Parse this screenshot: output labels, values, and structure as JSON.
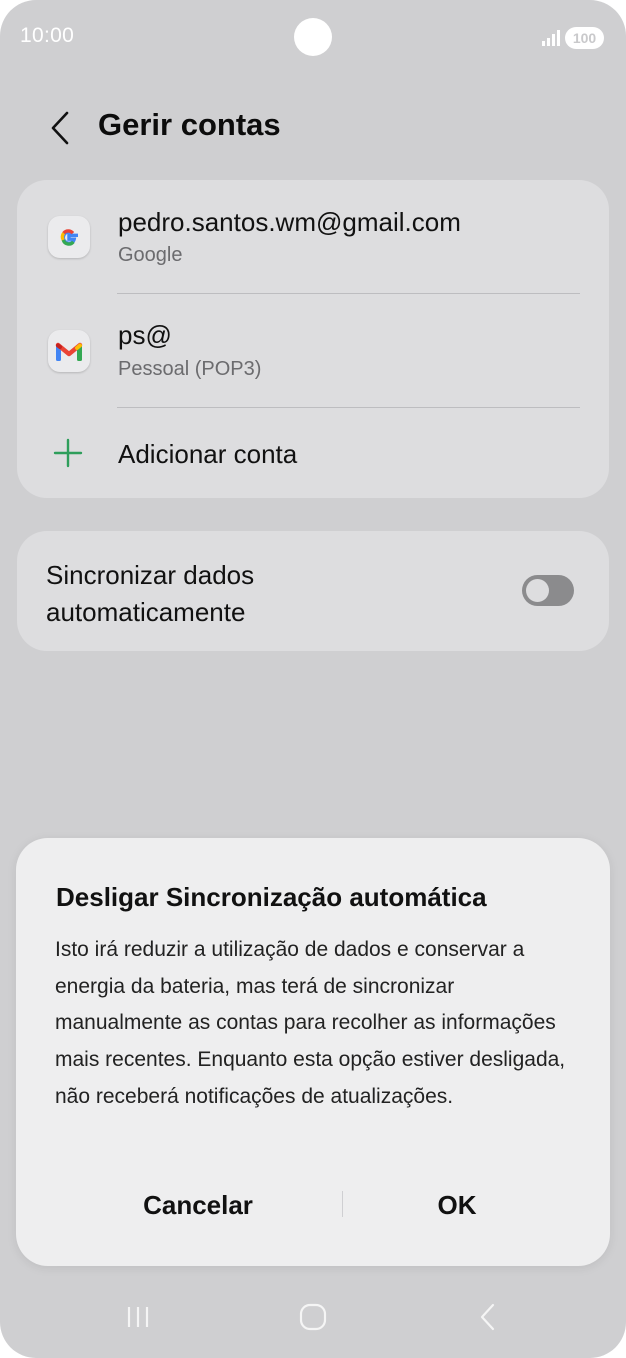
{
  "status_bar": {
    "time": "10:00",
    "battery": "100",
    "icons": [
      "signal-icon",
      "battery-icon"
    ]
  },
  "header": {
    "title": "Gerir contas",
    "back_icon": "chevron-left-icon"
  },
  "accounts": [
    {
      "name": "pedro.santos.wm@gmail.com",
      "type": "Google",
      "icon": "google-icon"
    },
    {
      "name": "ps@",
      "type": "Pessoal (POP3)",
      "icon": "gmail-icon"
    }
  ],
  "add_account": {
    "label": "Adicionar conta",
    "icon": "plus-icon"
  },
  "sync": {
    "label": "Sincronizar dados automaticamente",
    "enabled": false
  },
  "dialog": {
    "title": "Desligar Sincronização automática",
    "body": "Isto irá reduzir a utilização de dados e conservar a energia da bateria, mas terá de sincronizar manualmente as contas para recolher as informações mais recentes. Enquanto esta opção estiver desligada, não receberá notificações de atualizações.",
    "cancel_label": "Cancelar",
    "ok_label": "OK"
  },
  "nav_bar": {
    "icons": [
      "recent-apps-icon",
      "home-icon",
      "back-icon"
    ]
  },
  "colors": {
    "background": "#cfcfd1",
    "card": "#dddddf",
    "dialog": "#eeeeef",
    "accent_green": "#2e9e5b"
  }
}
